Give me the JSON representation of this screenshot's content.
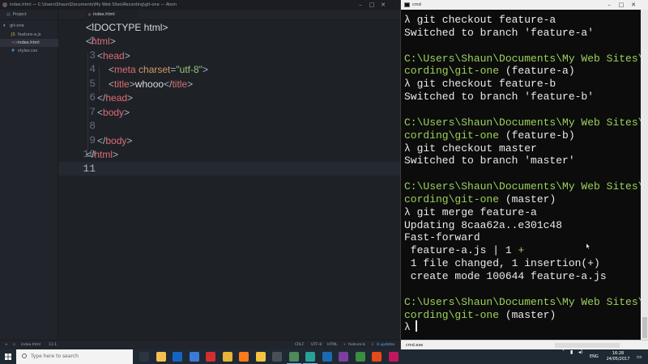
{
  "atom": {
    "window_title": "index.html — C:\\Users\\Shaun\\Documents\\My Web Sites\\Recording\\git-one — Atom",
    "tree": {
      "header": "Project",
      "items": [
        {
          "label": "git-one",
          "icon": "folder-icon"
        },
        {
          "label": "feature-a.js",
          "icon": "js-file-icon"
        },
        {
          "label": "index.html",
          "icon": "html-file-icon"
        },
        {
          "label": "styles.css",
          "icon": "css-file-icon"
        }
      ]
    },
    "tab": {
      "label": "index.html"
    },
    "line_numbers": [
      "1",
      "2",
      "3",
      "4",
      "5",
      "6",
      "7",
      "8",
      "9",
      "10",
      "11"
    ],
    "code": {
      "l1": "<!DOCTYPE html>",
      "l2_open": "<",
      "l2_tag": "html",
      "l2_close": ">",
      "l3_open": "<",
      "l3_tag": "head",
      "l3_close": ">",
      "l4_open": "<",
      "l4_tag": "meta",
      "l4_attr": " charset",
      "l4_eq": "=",
      "l4_val": "\"utf-8\"",
      "l4_close": ">",
      "l5_open": "<",
      "l5_tag": "title",
      "l5_close": ">",
      "l5_text": "whooo",
      "l5_end_open": "</",
      "l5_end_tag": "title",
      "l5_end_close": ">",
      "l6_open": "</",
      "l6_tag": "head",
      "l6_close": ">",
      "l7_open": "<",
      "l7_tag": "body",
      "l7_close": ">",
      "l9_open": "</",
      "l9_tag": "body",
      "l9_close": ">",
      "l10_open": "</",
      "l10_tag": "html",
      "l10_close": ">"
    },
    "status": {
      "file": "index.html",
      "position": "11:1",
      "line_ending": "CRLF",
      "encoding": "UTF-8",
      "grammar": "HTML",
      "branch": "feature-b",
      "updates": "4 updates"
    }
  },
  "cmd": {
    "window_title": "cmd",
    "lines": [
      {
        "text": "λ git checkout feature-a",
        "kind": "cmd"
      },
      {
        "text": "Switched to branch 'feature-a'",
        "kind": "out"
      },
      {
        "text": "",
        "kind": "blank"
      },
      {
        "text": "C:\\Users\\Shaun\\Documents\\My Web Sites\\Re",
        "kind": "path"
      },
      {
        "text": "cording\\git-one",
        "branch": " (feature-a)",
        "kind": "path2"
      },
      {
        "text": "λ git checkout feature-b",
        "kind": "cmd"
      },
      {
        "text": "Switched to branch 'feature-b'",
        "kind": "out"
      },
      {
        "text": "",
        "kind": "blank"
      },
      {
        "text": "C:\\Users\\Shaun\\Documents\\My Web Sites\\Re",
        "kind": "path"
      },
      {
        "text": "cording\\git-one",
        "branch": " (feature-b)",
        "kind": "path2"
      },
      {
        "text": "λ git checkout master",
        "kind": "cmd"
      },
      {
        "text": "Switched to branch 'master'",
        "kind": "out"
      },
      {
        "text": "",
        "kind": "blank"
      },
      {
        "text": "C:\\Users\\Shaun\\Documents\\My Web Sites\\Re",
        "kind": "path"
      },
      {
        "text": "cording\\git-one",
        "branch": " (master)",
        "kind": "path2"
      },
      {
        "text": "λ git merge feature-a",
        "kind": "cmd"
      },
      {
        "text": "Updating 8caa62a..e301c48",
        "kind": "out"
      },
      {
        "text": "Fast-forward",
        "kind": "out"
      },
      {
        "text": " feature-a.js | 1 ",
        "plus": "+",
        "kind": "diffstat"
      },
      {
        "text": " 1 file changed, 1 insertion(+)",
        "kind": "out"
      },
      {
        "text": " create mode 100644 feature-a.js",
        "kind": "out"
      },
      {
        "text": "",
        "kind": "blank"
      },
      {
        "text": "C:\\Users\\Shaun\\Documents\\My Web Sites\\Re",
        "kind": "path"
      },
      {
        "text": "cording\\git-one",
        "branch": " (master)",
        "kind": "path2"
      },
      {
        "text": "λ ",
        "kind": "cmd"
      }
    ],
    "status_label": "cmd.exe"
  },
  "taskbar": {
    "search_placeholder": "Type here to search",
    "apps": [
      {
        "icon": "task-view-icon",
        "color": "#2b3440"
      },
      {
        "icon": "file-explorer-icon",
        "color": "#f2c14e"
      },
      {
        "icon": "outlook-icon",
        "color": "#1565c0"
      },
      {
        "icon": "store-icon",
        "color": "#3a7bd5"
      },
      {
        "icon": "opera-icon",
        "color": "#d32f2f"
      },
      {
        "icon": "chrome-icon",
        "color": "#e8b339"
      },
      {
        "icon": "firefox-icon",
        "color": "#ff7a1a"
      },
      {
        "icon": "chrome-canary-icon",
        "color": "#f5c242"
      },
      {
        "icon": "folder-icon",
        "color": "#4a4f57"
      },
      {
        "icon": "atom-icon",
        "color": "#4e8a5a"
      },
      {
        "icon": "sourcetree-icon",
        "color": "#2aa198"
      },
      {
        "icon": "photoshop-icon",
        "color": "#1b6bb3"
      },
      {
        "icon": "premiere-icon",
        "color": "#7b3fa0"
      },
      {
        "icon": "camtasia-icon",
        "color": "#3c8d40"
      },
      {
        "icon": "git-icon",
        "color": "#e64a19"
      },
      {
        "icon": "other-app-icon",
        "color": "#c2185b"
      }
    ],
    "tray": {
      "language": "ENG",
      "time": "16:28",
      "date": "24/05/2017"
    }
  }
}
